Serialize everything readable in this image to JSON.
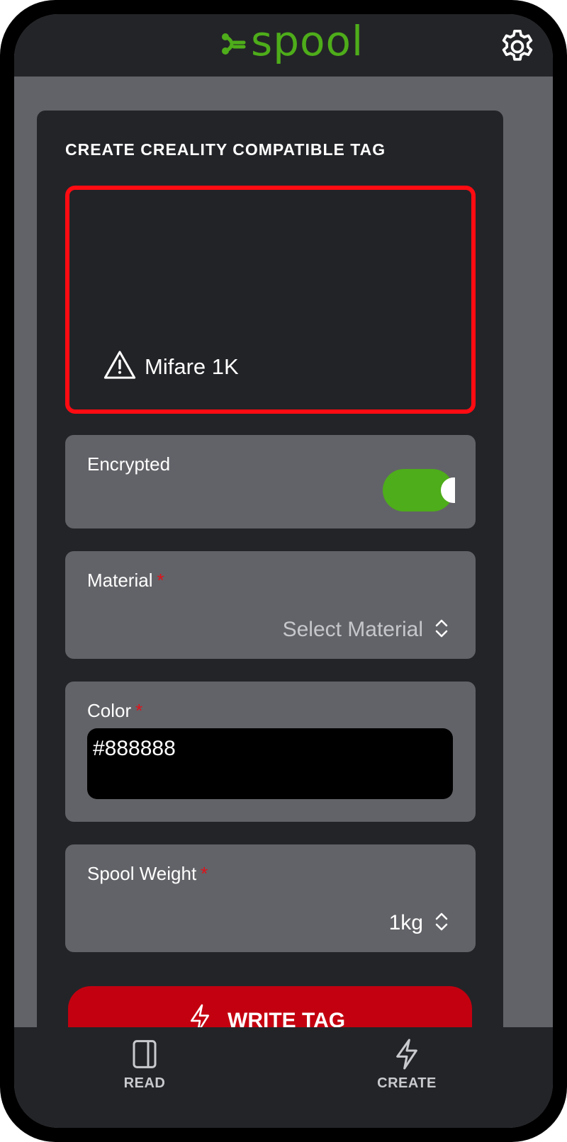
{
  "app": {
    "brand": "spool",
    "brand_color": "#4ead1a"
  },
  "card": {
    "title": "CREATE CREALITY COMPATIBLE TAG"
  },
  "tag": {
    "type": "Mifare 1K",
    "status_icon": "warning-icon",
    "border_color": "#ff0b12"
  },
  "encrypted": {
    "label": "Encrypted",
    "enabled": true
  },
  "material": {
    "label": "Material",
    "required_mark": "*",
    "value": "Select Material"
  },
  "color": {
    "label": "Color",
    "required_mark": "*",
    "value": "#888888"
  },
  "spool_weight": {
    "label": "Spool Weight",
    "required_mark": "*",
    "value": "1kg"
  },
  "write_button": {
    "label": "WRITE TAG",
    "icon": "lightning-icon",
    "color": "#c3000f"
  },
  "nav": {
    "items": [
      {
        "label": "READ",
        "icon": "book-icon"
      },
      {
        "label": "CREATE",
        "icon": "lightning-icon"
      }
    ]
  }
}
